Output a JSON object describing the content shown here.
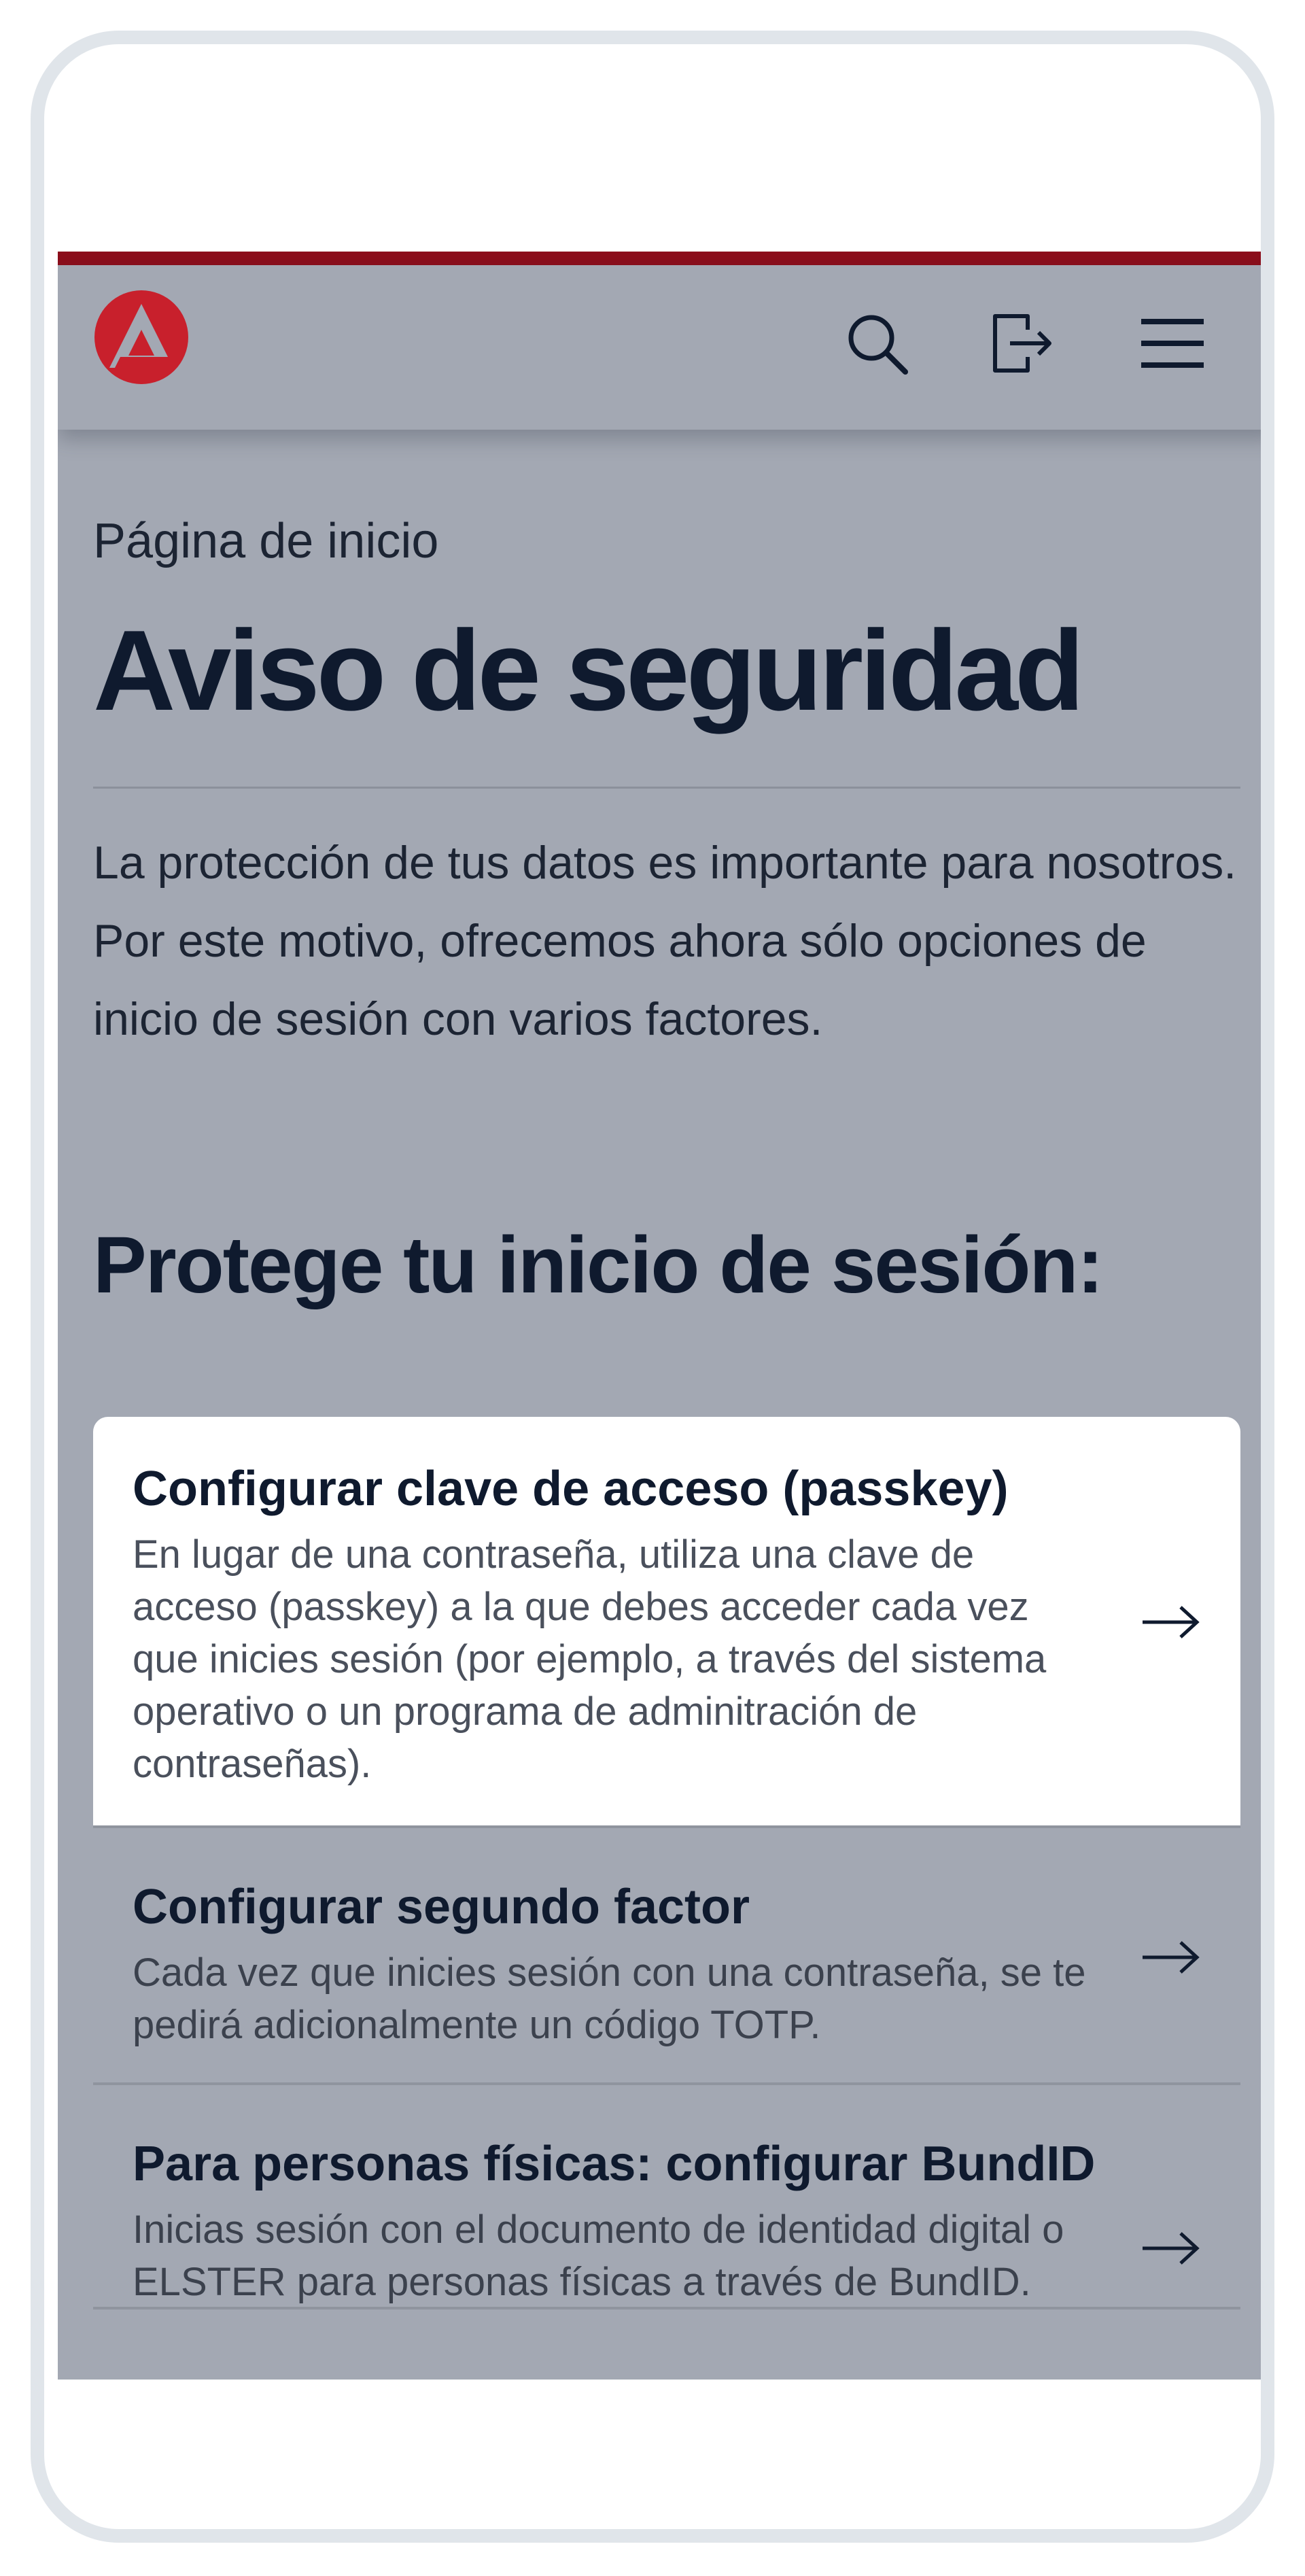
{
  "header": {
    "logo_icon": "agentur-fuer-arbeit-logo",
    "search_icon": "search-icon",
    "logout_icon": "logout-icon",
    "menu_icon": "hamburger-menu-icon",
    "brand_color": "#8c0e1b"
  },
  "breadcrumb": "Página de inicio",
  "page_title": "Aviso de seguridad",
  "intro": "La protección de tus datos es importante para nosotros. Por este motivo, ofrecemos ahora sólo opciones de inicio de sesión con varios factores.",
  "section_title": "Protege tu inicio de sesión:",
  "options": [
    {
      "title": "Configurar clave de acceso (passkey)",
      "description": "En lugar de una contraseña, utiliza una clave de acceso (passkey) a la que debes acceder cada vez que inicies sesión (por ejemplo, a través del sistema operativo o un programa de adminitración de contraseñas).",
      "arrow_icon": "arrow-right-icon"
    },
    {
      "title": "Configurar segundo factor",
      "description": "Cada vez que inicies sesión con una contraseña, se te pedirá adicionalmente un código TOTP.",
      "arrow_icon": "arrow-right-icon"
    },
    {
      "title": "Para personas físicas: configurar BundID",
      "description": "Inicias sesión con el documento de identidad digital o ELSTER para personas físicas a través de BundID.",
      "arrow_icon": "arrow-right-icon"
    }
  ]
}
